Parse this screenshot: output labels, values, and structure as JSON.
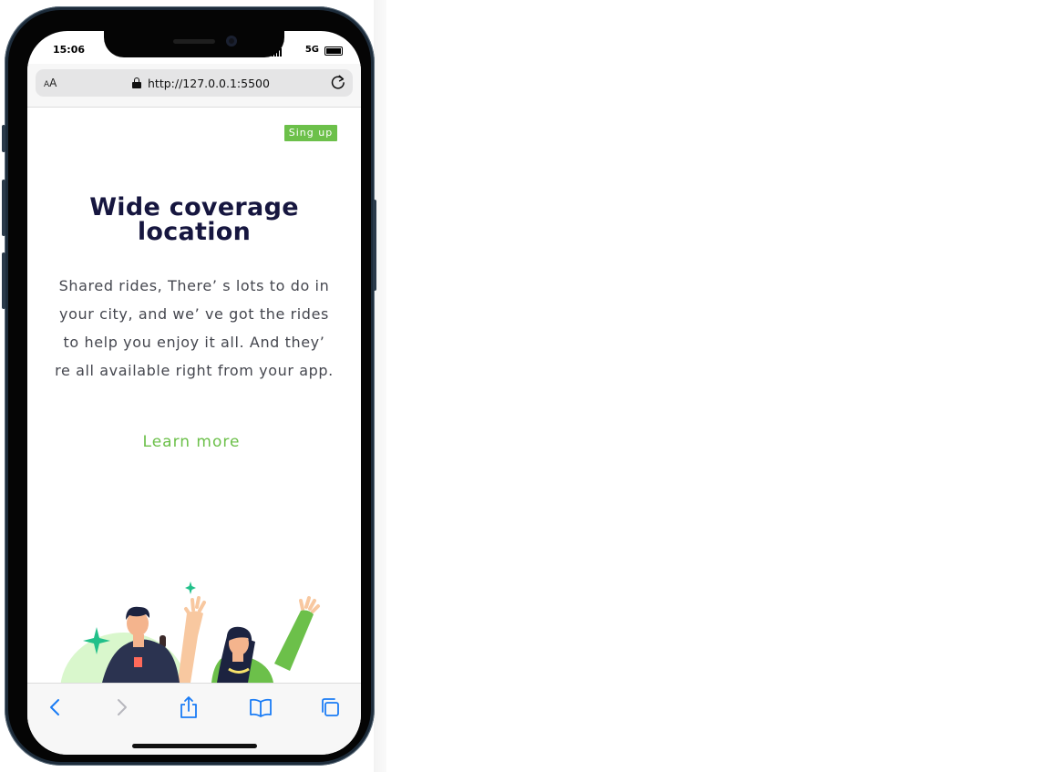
{
  "status_bar": {
    "time": "15:06",
    "network": "5G"
  },
  "browser": {
    "text_size_label": "AA",
    "url": "http://127.0.0.1:5500"
  },
  "page": {
    "signup_label": "Sing up",
    "title": "Wide coverage location",
    "description": "Shared rides, There’ s lots to do in your city, and we’ ve got the rides to help you enjoy it all. And they’ re all available right from your app.",
    "learn_more_label": "Learn more",
    "illustration": "people-waving-illustration"
  },
  "toolbar": {
    "icons": [
      "back-icon",
      "forward-icon",
      "share-icon",
      "bookmarks-icon",
      "tabs-icon"
    ]
  },
  "colors": {
    "accent_green": "#6cc04a",
    "title_navy": "#16163f",
    "safari_blue": "#1a7cf5",
    "phone_frame": "#1d2c3b"
  }
}
